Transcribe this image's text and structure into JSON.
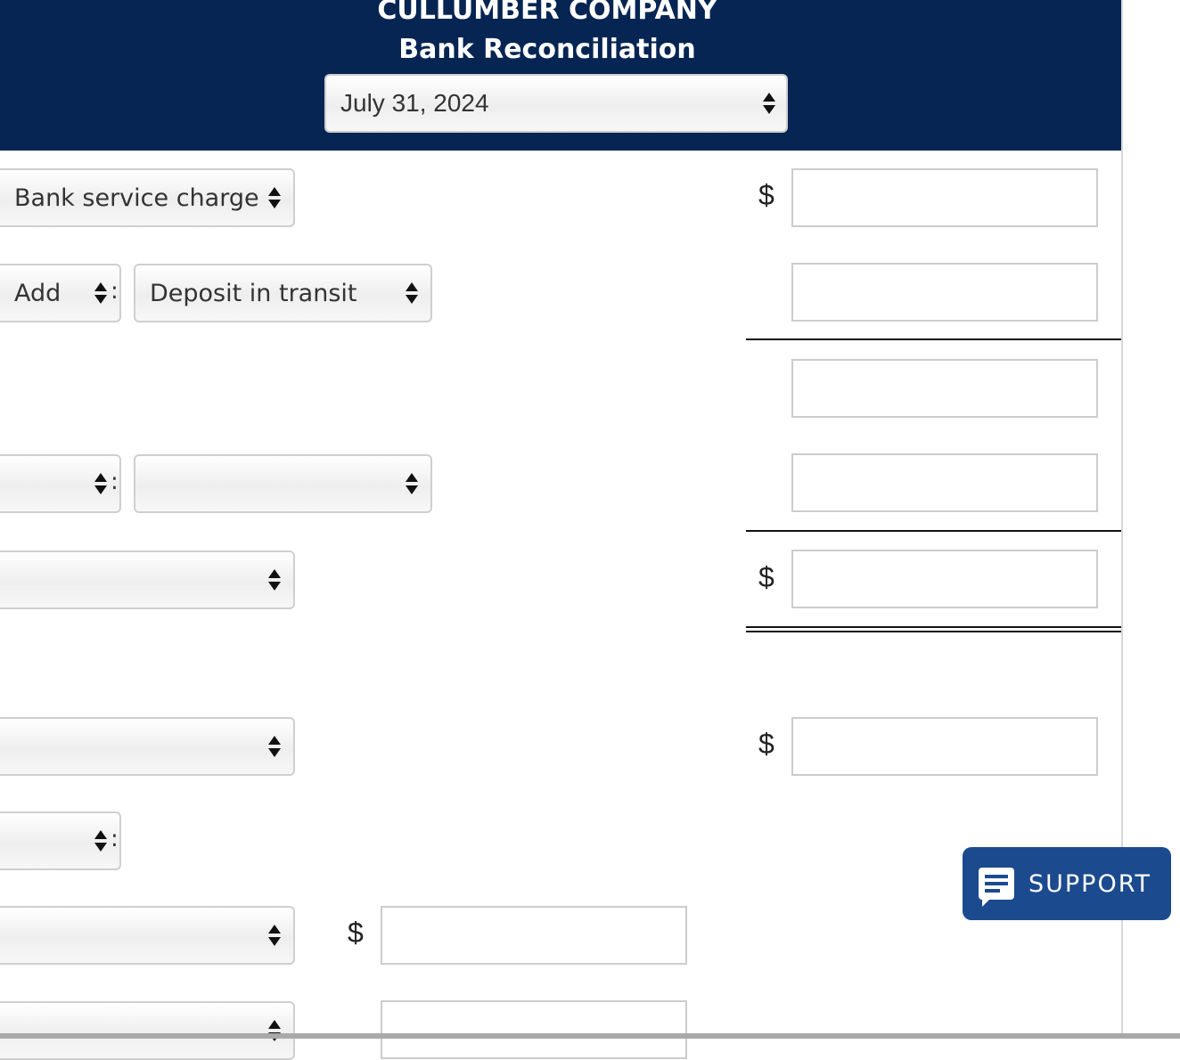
{
  "header": {
    "company": "CULLUMBER COMPANY",
    "statement": "Bank Reconciliation",
    "date": "July 31, 2024"
  },
  "rows": {
    "r1_label": "Bank service charge",
    "r2_op": "Add",
    "r2_item": "Deposit in transit"
  },
  "currency_symbol": "$",
  "support": {
    "label": "SUPPORT"
  }
}
